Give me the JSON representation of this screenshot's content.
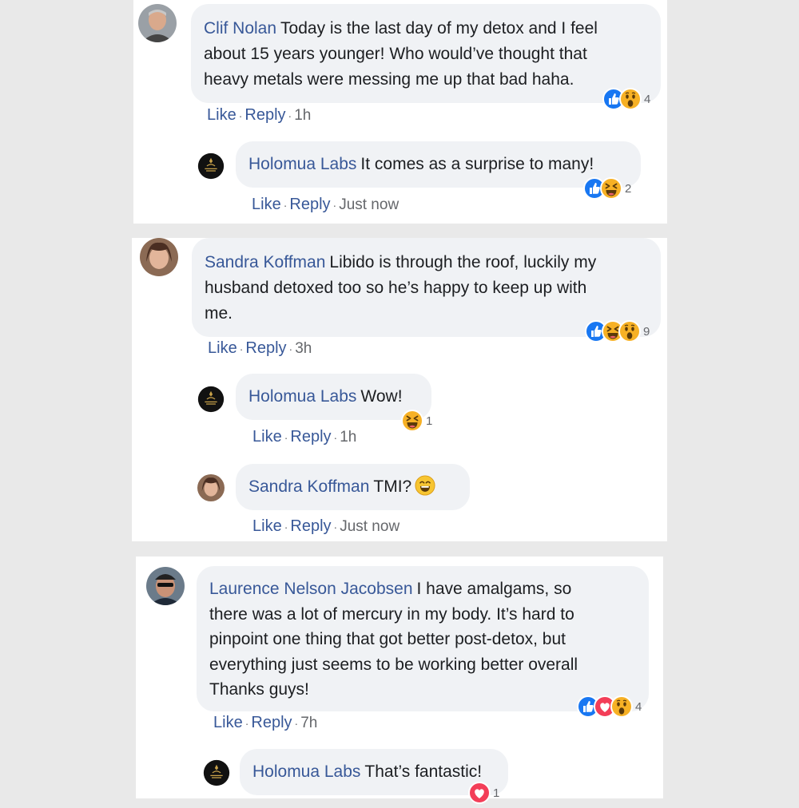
{
  "cards": [
    {
      "comment": {
        "author": "Clif Nolan",
        "lines": [
          "Today is the last day of my detox and I feel",
          "about 15 years younger! Who would’ve thought that",
          "heavy metals were messing me up that bad haha."
        ],
        "like": "Like",
        "reply": "Reply",
        "sep": "·",
        "time": "1h",
        "reactions": [
          "like",
          "wow"
        ],
        "reaction_count": "4"
      },
      "replies": [
        {
          "author": "Holomua Labs",
          "text": "It comes as a surprise to many!",
          "like": "Like",
          "reply": "Reply",
          "sep": "·",
          "time": "Just now",
          "reactions": [
            "like",
            "haha"
          ],
          "reaction_count": "2"
        }
      ]
    },
    {
      "comment": {
        "author": "Sandra Koffman",
        "lines": [
          "Libido is through the roof, luckily my",
          "husband detoxed too so he’s happy to keep up with",
          "me."
        ],
        "like": "Like",
        "reply": "Reply",
        "sep": "·",
        "time": "3h",
        "reactions": [
          "like",
          "haha",
          "wow"
        ],
        "reaction_count": "9"
      },
      "replies": [
        {
          "author": "Holomua Labs",
          "text": "Wow!",
          "like": "Like",
          "reply": "Reply",
          "sep": "·",
          "time": "1h",
          "reactions": [
            "haha"
          ],
          "reaction_count": "1"
        },
        {
          "author": "Sandra Koffman",
          "text": "TMI?",
          "like": "Like",
          "reply": "Reply",
          "sep": "·",
          "time": "Just now",
          "inline_emoji": "laughing-face"
        }
      ]
    },
    {
      "comment": {
        "author": "Laurence Nelson Jacobsen",
        "lines": [
          "I have amalgams, so",
          "there was a lot of mercury in my body. It’s hard to",
          "pinpoint one thing that got better post-detox, but",
          "everything just seems to be working better overall",
          "Thanks guys!"
        ],
        "like": "Like",
        "reply": "Reply",
        "sep": "·",
        "time": "7h",
        "reactions": [
          "like",
          "love",
          "wow"
        ],
        "reaction_count": "4"
      },
      "replies": [
        {
          "author": "Holomua Labs",
          "text": "That’s fantastic!",
          "reactions": [
            "love"
          ],
          "reaction_count": "1"
        }
      ]
    }
  ],
  "colors": {
    "name_blue": "#385898",
    "bubble_gray": "#f0f2f5",
    "like_blue": "#1877f2",
    "love_red": "#f33e58",
    "emoji_yellow": "#f7b125",
    "page_bg": "#e9e9e9"
  }
}
